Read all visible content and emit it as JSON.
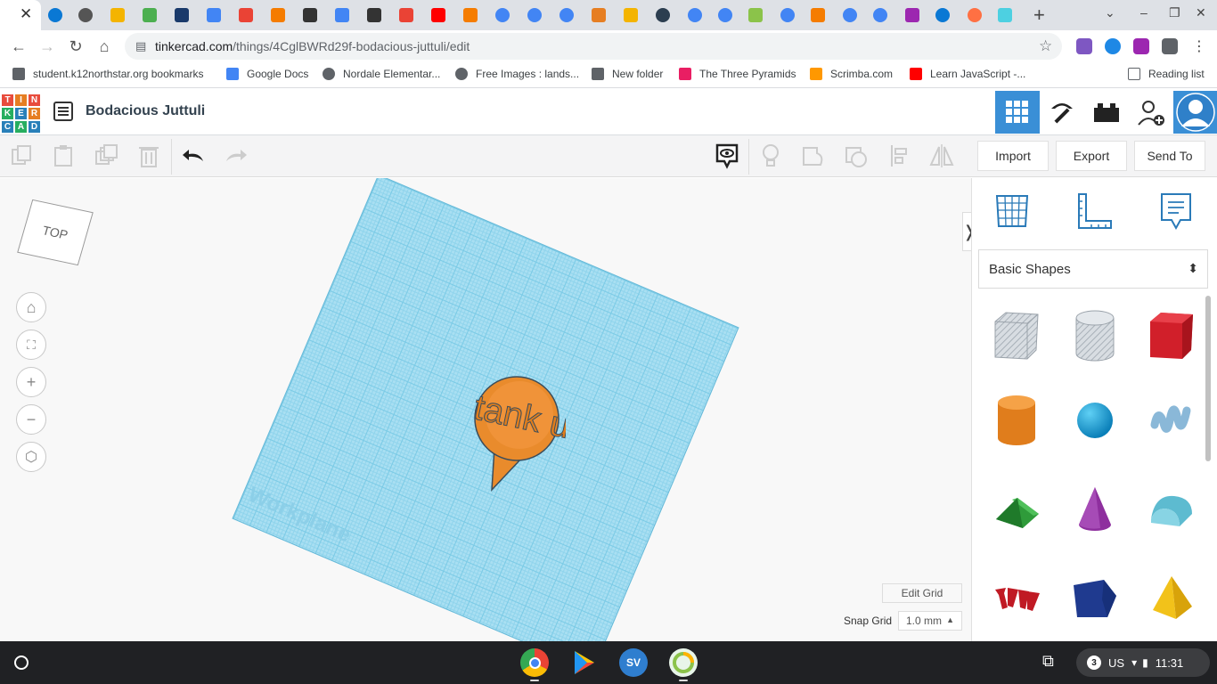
{
  "browser": {
    "active_tab_close": "✕",
    "new_tab": "+",
    "tab_search": "⌄",
    "minimize": "–",
    "restore": "❐",
    "close": "✕",
    "url_host": "tinkercad.com",
    "url_path": "/things/4CglBWRd29f-bodacious-juttuli/edit",
    "bookmarks": [
      {
        "label": "student.k12northstar.org bookmarks",
        "color": "#5f6368"
      },
      {
        "label": "Google Docs",
        "color": "#4285f4"
      },
      {
        "label": "Nordale Elementar...",
        "color": "#5f6368"
      },
      {
        "label": "Free Images : lands...",
        "color": "#5f6368"
      },
      {
        "label": "New folder",
        "color": "#5f6368"
      },
      {
        "label": "The Three Pyramids",
        "color": "#e91e63"
      },
      {
        "label": "Scrimba.com",
        "color": "#ff9800"
      },
      {
        "label": "Learn JavaScript -...",
        "color": "#ff0000"
      }
    ],
    "reading_list": "Reading list"
  },
  "tinkercad": {
    "logo_letters": [
      "T",
      "I",
      "N",
      "K",
      "E",
      "R",
      "C",
      "A",
      "D"
    ],
    "logo_colors": [
      "#e84c3d",
      "#e67e22",
      "#e84c3d",
      "#27ae60",
      "#2980b9",
      "#e67e22",
      "#2980b9",
      "#27ae60",
      "#2980b9"
    ],
    "design_title": "Bodacious Juttuli",
    "accent": "#3a8fd6",
    "toolbar": {
      "import": "Import",
      "export": "Export",
      "send_to": "Send To"
    },
    "viewcube_label": "TOP",
    "workplane_label": "Workplane",
    "model_text": "tank u",
    "edit_grid": "Edit Grid",
    "snap_grid_label": "Snap Grid",
    "snap_grid_value": "1.0 mm",
    "snap_grid_arrow": "▲",
    "panel_toggle": "❭",
    "shapes_category": "Basic Shapes",
    "shapes_category_arrow": "⬍",
    "view_controls": [
      "home-icon",
      "fit-icon",
      "zoom-in-icon",
      "zoom-out-icon",
      "perspective-icon"
    ]
  },
  "shelf": {
    "status_count": "3",
    "keyboard": "US",
    "time": "11:31"
  }
}
